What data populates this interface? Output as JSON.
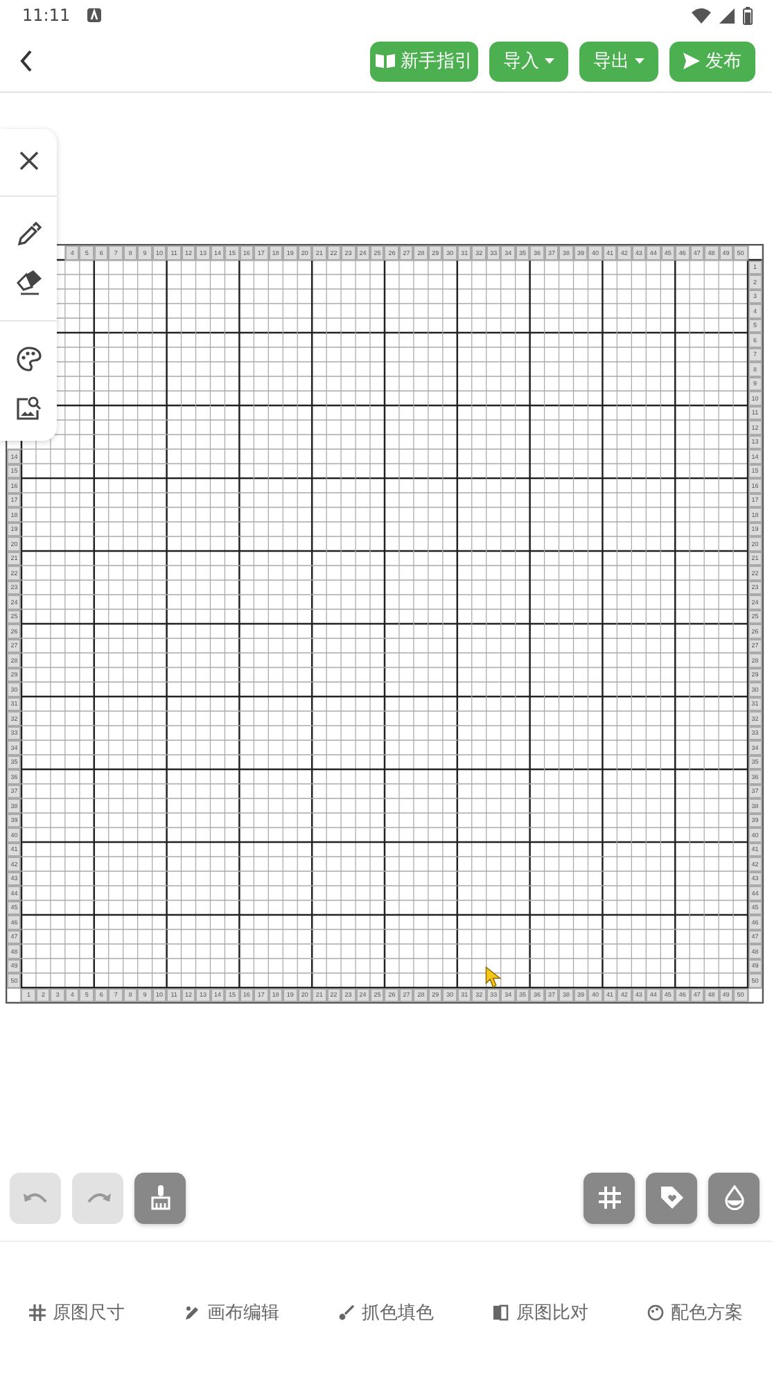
{
  "status_bar": {
    "time": "11:11"
  },
  "header": {
    "buttons": [
      {
        "label": "新手指引",
        "kind": "guide"
      },
      {
        "label": "导入",
        "kind": "dropdown"
      },
      {
        "label": "导出",
        "kind": "dropdown"
      },
      {
        "label": "发布",
        "kind": "send"
      }
    ]
  },
  "side_tools": [
    {
      "kind": "close"
    },
    {
      "kind": "picker"
    },
    {
      "kind": "eraser"
    },
    {
      "kind": "palette"
    },
    {
      "kind": "image-search"
    }
  ],
  "grid": {
    "top_labels": [
      "4",
      "5",
      "6",
      "7",
      "8",
      "9",
      "10",
      "11",
      "12",
      "13",
      "14",
      "15",
      "16",
      "17",
      "18",
      "19",
      "20",
      "21",
      "22",
      "23",
      "24",
      "25",
      "26",
      "27",
      "28",
      "29",
      "30",
      "31",
      "32",
      "33",
      "34",
      "35",
      "36",
      "37",
      "38",
      "39",
      "40",
      "41",
      "42",
      "43",
      "44",
      "45",
      "46",
      "47",
      "48",
      "49",
      "50"
    ],
    "left_labels": [
      "14",
      "15",
      "16",
      "17",
      "18",
      "19",
      "20",
      "21",
      "22",
      "23",
      "24",
      "25",
      "26",
      "27",
      "28",
      "29",
      "30",
      "31",
      "32",
      "33",
      "34",
      "35",
      "36",
      "37",
      "38",
      "39",
      "40",
      "41",
      "42",
      "43",
      "44",
      "45",
      "46",
      "47",
      "48",
      "49",
      "50"
    ],
    "right_labels": [
      "1",
      "2",
      "3",
      "4",
      "5",
      "6",
      "7",
      "8",
      "9",
      "10",
      "11",
      "12",
      "13",
      "14",
      "15",
      "16",
      "17",
      "18",
      "19",
      "20",
      "21",
      "22",
      "23",
      "24",
      "25",
      "26",
      "27",
      "28",
      "29",
      "30",
      "31",
      "32",
      "33",
      "34",
      "35",
      "36",
      "37",
      "38",
      "39",
      "40",
      "41",
      "42",
      "43",
      "44",
      "45",
      "46",
      "47",
      "48",
      "49",
      "50"
    ],
    "bottom_labels": [
      "1",
      "2",
      "3",
      "4",
      "5",
      "6",
      "7",
      "8",
      "9",
      "10",
      "11",
      "12",
      "13",
      "14",
      "15",
      "16",
      "17",
      "18",
      "19",
      "20",
      "21",
      "22",
      "23",
      "24",
      "25",
      "26",
      "27",
      "28",
      "29",
      "30",
      "31",
      "32",
      "33",
      "34",
      "35",
      "36",
      "37",
      "38",
      "39",
      "40",
      "41",
      "42",
      "43",
      "44",
      "45",
      "46",
      "47",
      "48",
      "49",
      "50"
    ]
  },
  "left_actions": [
    {
      "kind": "undo",
      "disabled": true
    },
    {
      "kind": "redo",
      "disabled": true
    },
    {
      "kind": "brush",
      "disabled": false
    }
  ],
  "right_actions": [
    {
      "kind": "grid"
    },
    {
      "kind": "tag"
    },
    {
      "kind": "drop"
    }
  ],
  "tabs": [
    {
      "label": "原图尺寸",
      "kind": "grid"
    },
    {
      "label": "画布编辑",
      "kind": "edit"
    },
    {
      "label": "抓色填色",
      "kind": "brush"
    },
    {
      "label": "原图比对",
      "kind": "compare"
    },
    {
      "label": "配色方案",
      "kind": "palette"
    }
  ]
}
